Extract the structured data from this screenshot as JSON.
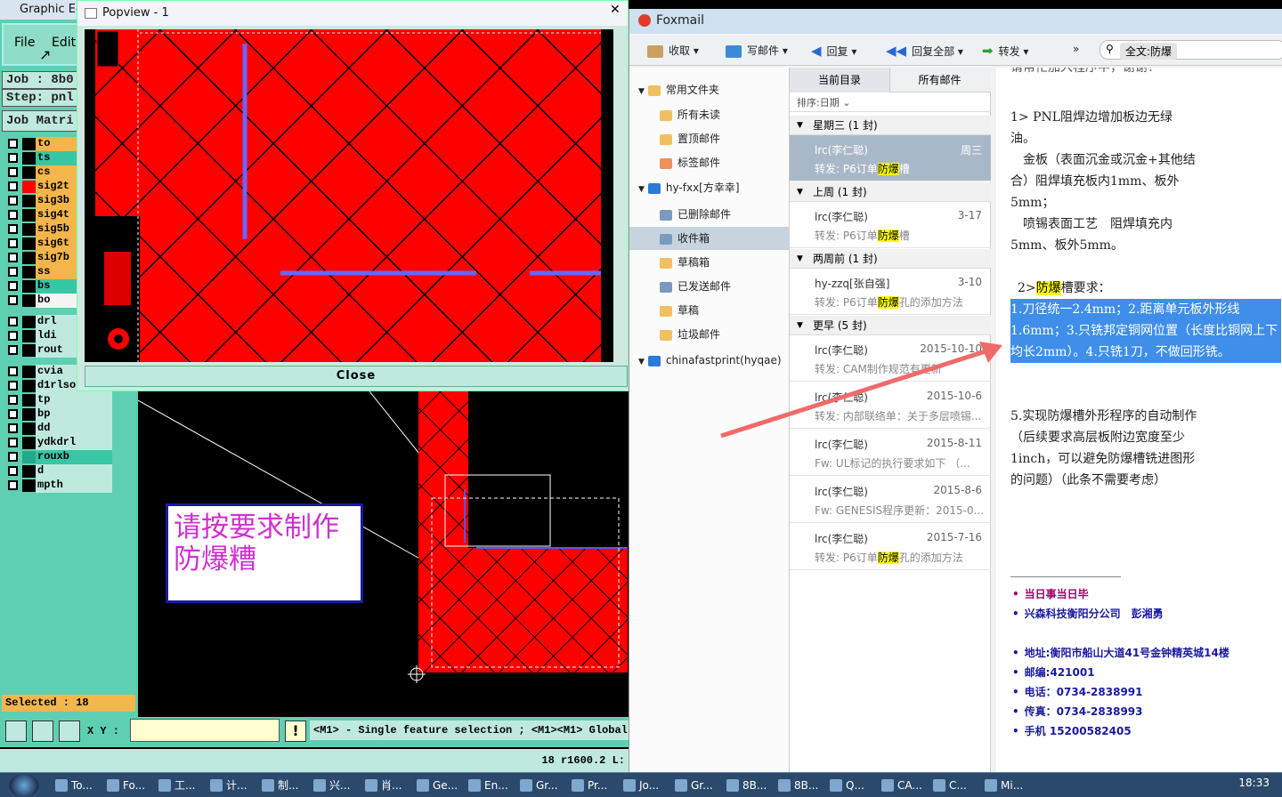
{
  "genesis": {
    "title": "Graphic Edi",
    "menu": {
      "file": "File",
      "edit": "Edit"
    },
    "job": "Job : 8b0",
    "step": "Step: pnl",
    "job_matrix": "Job Matri",
    "layers": [
      {
        "name": "to",
        "color": "#f4b54a",
        "sw": "#000"
      },
      {
        "name": "ts",
        "color": "#38c7a5",
        "sw": "#000"
      },
      {
        "name": "cs",
        "color": "#f4b54a",
        "sw": "#000"
      },
      {
        "name": "sig2t",
        "color": "#f4b54a",
        "sw": "#f00"
      },
      {
        "name": "sig3b",
        "color": "#f4b54a",
        "sw": "#000"
      },
      {
        "name": "sig4t",
        "color": "#f4b54a",
        "sw": "#000"
      },
      {
        "name": "sig5b",
        "color": "#f4b54a",
        "sw": "#000"
      },
      {
        "name": "sig6t",
        "color": "#f4b54a",
        "sw": "#000"
      },
      {
        "name": "sig7b",
        "color": "#f4b54a",
        "sw": "#000"
      },
      {
        "name": "ss",
        "color": "#f4b54a",
        "sw": "#000"
      },
      {
        "name": "bs",
        "color": "#38c7a5",
        "sw": "#000"
      },
      {
        "name": "bo",
        "color": "#f4f4f4",
        "sw": "#000"
      },
      {
        "name": "drl",
        "color": "#bfe9df",
        "sw": "#000"
      },
      {
        "name": "ldi",
        "color": "#bfe9df",
        "sw": "#000"
      },
      {
        "name": "rout",
        "color": "#bfe9df",
        "sw": "#000"
      },
      {
        "name": "cvia",
        "color": "#bfe9df",
        "sw": "#000"
      },
      {
        "name": "d1rlso",
        "color": "#bfe9df",
        "sw": "#000"
      },
      {
        "name": "tp",
        "color": "#bfe9df",
        "sw": "#000"
      },
      {
        "name": "bp",
        "color": "#bfe9df",
        "sw": "#000"
      },
      {
        "name": "dd",
        "color": "#bfe9df",
        "sw": "#000"
      },
      {
        "name": "ydkdrl",
        "color": "#bfe9df",
        "sw": "#000"
      },
      {
        "name": "rouxb",
        "color": "#38c7a5",
        "sw": "#2a8"
      },
      {
        "name": "d",
        "color": "#bfe9df",
        "sw": "#000"
      },
      {
        "name": "mpth",
        "color": "#bfe9df",
        "sw": "#000"
      }
    ],
    "selected": "Selected : 18",
    "xy_label": "X Y :",
    "status": "<M1> - Single feature selection ; <M1><M1> Global",
    "coords": "18 r1600.2 L:"
  },
  "popview": {
    "title": "Popview - 1",
    "close": "Close"
  },
  "note": "请按要求制作防爆糟",
  "foxmail": {
    "title": "Foxmail",
    "toolbar": [
      "收取",
      "写邮件",
      "回复",
      "回复全部",
      "转发"
    ],
    "more": "»",
    "search": "全文:防爆",
    "folders": [
      {
        "label": "常用文件夹",
        "level": 0,
        "color": "#f0c060"
      },
      {
        "label": "所有未读",
        "level": 1,
        "color": "#f0c060"
      },
      {
        "label": "置顶邮件",
        "level": 1,
        "color": "#f0c060"
      },
      {
        "label": "标签邮件",
        "level": 1,
        "color": "#f09060"
      },
      {
        "label": "hy-fxx[方幸幸]",
        "level": 0,
        "color": "#2a7ad8"
      },
      {
        "label": "已删除邮件",
        "level": 1,
        "color": "#7a9ac0"
      },
      {
        "label": "收件箱",
        "level": 1,
        "color": "#7a9ac0",
        "sel": true
      },
      {
        "label": "草稿箱",
        "level": 1,
        "color": "#f0c060"
      },
      {
        "label": "已发送邮件",
        "level": 1,
        "color": "#7a9ac0"
      },
      {
        "label": "草稿",
        "level": 1,
        "color": "#f0c060"
      },
      {
        "label": "垃圾邮件",
        "level": 1,
        "color": "#f0c060"
      },
      {
        "label": "chinafastprint(hyqae)",
        "level": 0,
        "color": "#2a7ad8"
      }
    ],
    "tabs": {
      "current": "当前目录",
      "all": "所有邮件"
    },
    "sort": "排序:日期",
    "groups": [
      {
        "label": "星期三 (1 封)",
        "mails": [
          {
            "from": "lrc(李仁聪)",
            "date": "周三",
            "pre": "转发: P6订单",
            "hl": "防爆",
            "post": "槽",
            "sel": true
          }
        ]
      },
      {
        "label": "上周 (1 封)",
        "mails": [
          {
            "from": "lrc(李仁聪)",
            "date": "3-17",
            "pre": "转发: P6订单",
            "hl": "防爆",
            "post": "槽"
          }
        ]
      },
      {
        "label": "两周前 (1 封)",
        "mails": [
          {
            "from": "hy-zzq[张自强]",
            "date": "3-10",
            "pre": "转发: P6订单",
            "hl": "防爆",
            "post": "孔的添加方法"
          }
        ]
      },
      {
        "label": "更早 (5 封)",
        "mails": [
          {
            "from": "lrc(李仁聪)",
            "date": "2015-10-10",
            "pre": "转发: CAM制作规范有更新",
            "hl": "",
            "post": ""
          },
          {
            "from": "lrc(李仁聪)",
            "date": "2015-10-6",
            "pre": "转发: 内部联络单：关于多层喷锡...",
            "hl": "",
            "post": ""
          },
          {
            "from": "lrc(李仁聪)",
            "date": "2015-8-11",
            "pre": "Fw: UL标记的执行要求如下 （...",
            "hl": "",
            "post": ""
          },
          {
            "from": "lrc(李仁聪)",
            "date": "2015-8-6",
            "pre": "Fw: GENESIS程序更新：2015-0...",
            "hl": "",
            "post": ""
          },
          {
            "from": "lrc(李仁聪)",
            "date": "2015-7-16",
            "pre": "转发: P6订单",
            "hl": "防爆",
            "post": "孔的添加方法"
          }
        ]
      }
    ],
    "reader": {
      "top": "请帮忙加入程序中，谢谢！",
      "p1": "1> PNL阻焊边增加板边无绿油。",
      "p2": "金板（表面沉金或沉金+其他结合）阻焊填充板内1mm、板外5mm；",
      "p3": "喷锡表面工艺　阻焊填充内5mm、板外5mm。",
      "p4a": "2>",
      "p4hl": "防爆",
      "p4b": "槽要求：",
      "p5": "1.刀径统一2.4mm；2.距离单元板外形线1.6mm；3.只铣邦定铜网位置（长度比铜网上下均长2mm）。4.只铣1刀，不做回形铣。",
      "p6": "5.实现防爆槽外形程序的自动制作（后续要求高层板附边宽度至少1inch，可以避免防爆槽铣进图形的问题）（此条不需要考虑）",
      "sig": [
        "当日事当日毕",
        "兴森科技衡阳分公司　彭湘勇",
        "地址:衡阳市船山大道41号金钟精英城14楼",
        "邮编:421001",
        "电话：0734-2838991",
        "传真：0734-2838993",
        "手机 15200582405"
      ]
    }
  },
  "taskbar": {
    "items": [
      "To...",
      "Fo...",
      "工...",
      "计...",
      "制...",
      "兴...",
      "肖...",
      "Ge...",
      "En...",
      "Gr...",
      "Pr...",
      "Jo...",
      "Gr...",
      "8B...",
      "8B...",
      "Q...",
      "CA...",
      "C...",
      "Mi..."
    ],
    "clock": "18:33"
  }
}
